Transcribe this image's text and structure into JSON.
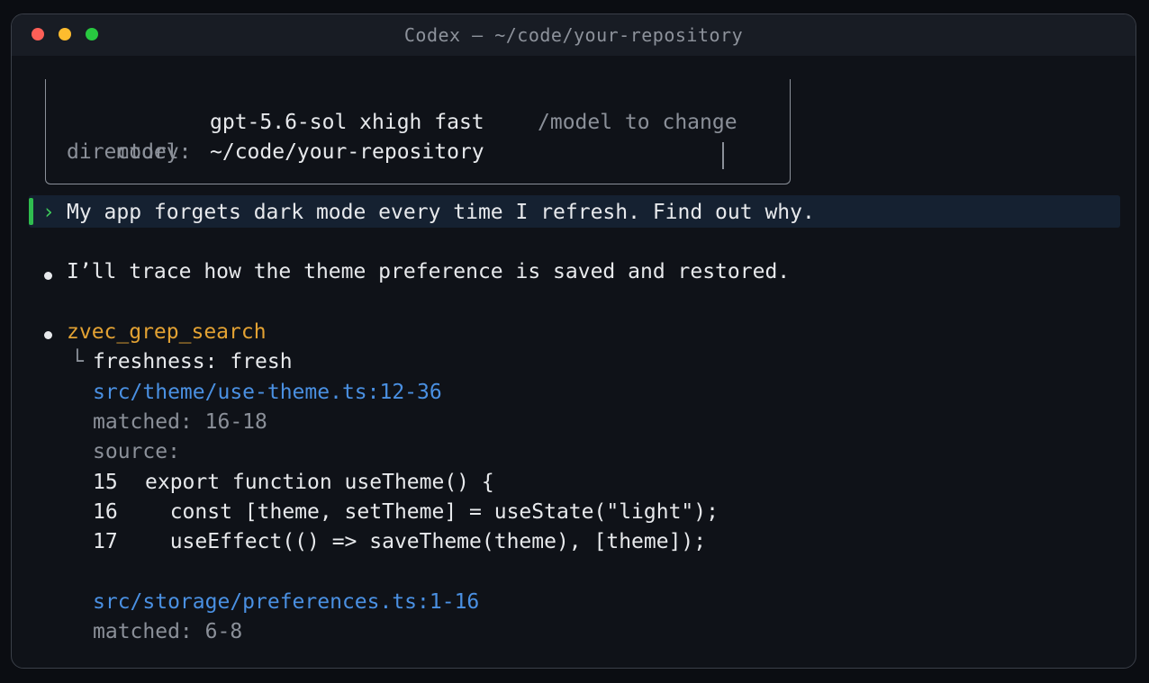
{
  "window": {
    "title": "Codex — ~/code/your-repository"
  },
  "session": {
    "model_label": "model:",
    "model_value": "gpt-5.6-sol xhigh fast",
    "model_hint": "/model to change",
    "directory_label": "directory:",
    "directory_value": "~/code/your-repository"
  },
  "prompt": {
    "chevron": "›",
    "text": "My app forgets dark mode every time I refresh. Find out why."
  },
  "messages": {
    "assistant_text": "I’ll trace how the theme preference is saved and restored.",
    "tool_name": "zvec_grep_search",
    "tree_branch": "└",
    "freshness": "freshness: fresh",
    "result1": {
      "path": "src/theme/use-theme.ts:12-36",
      "matched": "matched: 16-18",
      "source_label": "source:",
      "code": [
        {
          "num": "15",
          "text": "export function useTheme() {"
        },
        {
          "num": "16",
          "text": "  const [theme, setTheme] = useState(\"light\");"
        },
        {
          "num": "17",
          "text": "  useEffect(() => saveTheme(theme), [theme]);"
        }
      ]
    },
    "result2": {
      "path": "src/storage/preferences.ts:1-16",
      "matched": "matched: 6-8"
    }
  },
  "colors": {
    "accent_green": "#2fbd4f",
    "tool_orange": "#e3a233",
    "link_blue": "#4a90e2"
  }
}
